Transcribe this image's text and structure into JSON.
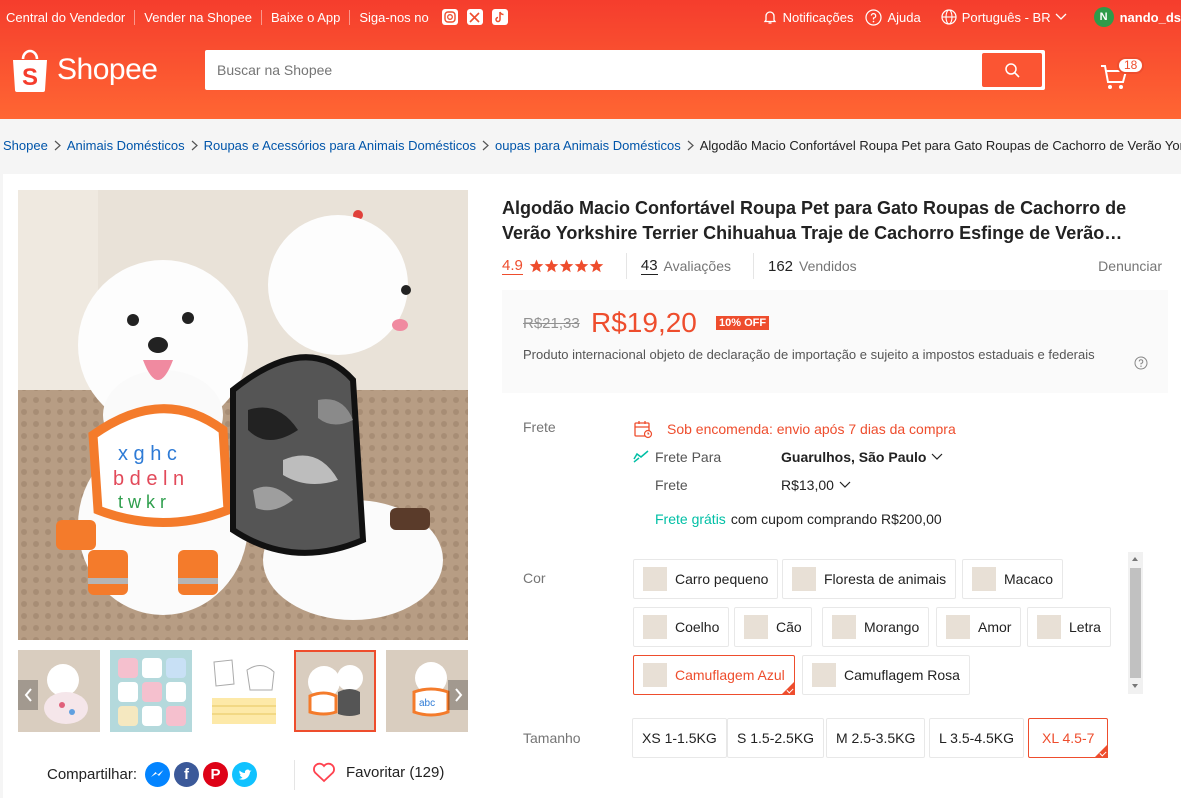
{
  "topbar": {
    "links": [
      "Central do Vendedor",
      "Vender na Shopee",
      "Baixe o App",
      "Siga-nos no"
    ],
    "notifications": "Notificações",
    "help": "Ajuda",
    "language": "Português - BR",
    "user_initial": "N",
    "username": "nando_ds"
  },
  "header": {
    "logo_text": "Shopee",
    "search_placeholder": "Buscar na Shopee",
    "cart_count": "18"
  },
  "breadcrumb": {
    "items": [
      "Shopee",
      "Animais Domésticos",
      "Roupas e Acessórios para Animais Domésticos",
      "oupas para Animais Domésticos"
    ],
    "current": "Algodão Macio Confortável Roupa Pet para Gato Roupas de Cachorro de Verão Yorkshire Terrier Chihuahua Traje de Cachorro Esfinge de Verão"
  },
  "product": {
    "title": "Algodão Macio Confortável Roupa Pet para Gato Roupas de Cachorro de Verão Yorkshire Terrier Chihuahua Traje de Cachorro Esfinge de Verão…",
    "rating": "4.9",
    "stars": 5,
    "reviews_count": "43",
    "reviews_label": "Avaliações",
    "sold_count": "162",
    "sold_label": "Vendidos",
    "report": "Denunciar",
    "old_price": "R$21,33",
    "price": "R$19,20",
    "discount": "10% OFF",
    "intl_note": "Produto internacional objeto de declaração de importação e sujeito a impostos estaduais e federais"
  },
  "shipping": {
    "label": "Frete",
    "preorder": "Sob encomenda: envio após 7 dias da compra",
    "to_label": "Frete Para",
    "to_value": "Guarulhos, São Paulo",
    "fee_label": "Frete",
    "fee_value": "R$13,00",
    "free_label": "Frete grátis",
    "free_rest": "com cupom comprando R$200,00"
  },
  "color": {
    "label": "Cor",
    "options": [
      "Carro pequeno",
      "Floresta de animais",
      "Macaco",
      "Coelho",
      "Cão",
      "Morango",
      "Amor",
      "Letra",
      "Camuflagem Azul",
      "Camuflagem Rosa"
    ],
    "selected": "Camuflagem Azul"
  },
  "size": {
    "label": "Tamanho",
    "options": [
      "XS 1-1.5KG",
      "S 1.5-2.5KG",
      "M 2.5-3.5KG",
      "L 3.5-4.5KG",
      "XL 4.5-7"
    ],
    "selected": "XL 4.5-7"
  },
  "share": {
    "label": "Compartilhar:",
    "networks": [
      "messenger-icon",
      "facebook-icon",
      "pinterest-icon",
      "twitter-icon"
    ]
  },
  "favorite": {
    "label": "Favoritar (129)"
  },
  "colors": {
    "brand": "#ee4d2d",
    "link": "#0055aa",
    "free_shipping": "#00bfa5"
  }
}
